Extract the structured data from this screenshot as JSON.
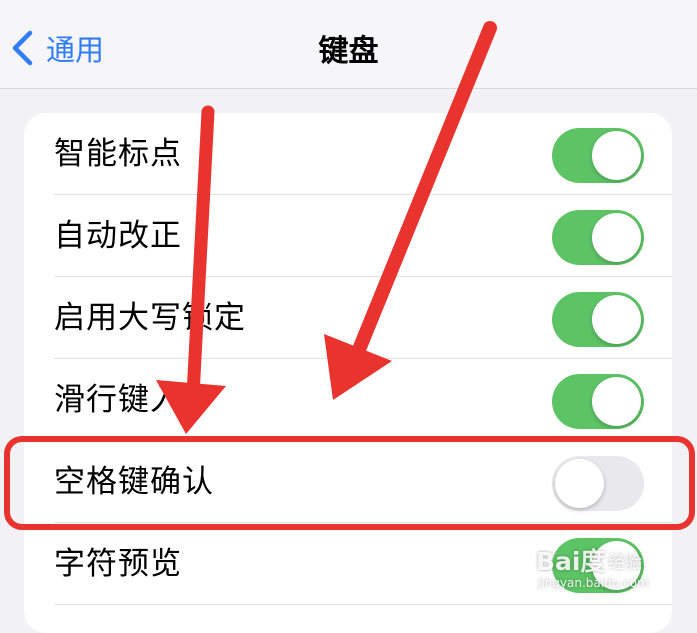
{
  "navbar": {
    "back_label": "通用",
    "title": "键盘"
  },
  "settings": [
    {
      "label": "智能标点",
      "enabled": true
    },
    {
      "label": "自动改正",
      "enabled": true
    },
    {
      "label": "启用大写锁定",
      "enabled": true
    },
    {
      "label": "滑行键入",
      "enabled": true
    },
    {
      "label": "空格键确认",
      "enabled": false
    },
    {
      "label": "字符预览",
      "enabled": true
    }
  ],
  "watermark": {
    "logo": "Bai度",
    "text": "经验",
    "url": "jingyan.baidu.com"
  },
  "colors": {
    "accent": "#2f7cf6",
    "toggle_on": "#5dc465",
    "toggle_off": "#e9e9eb",
    "annotation": "#e8332e"
  }
}
